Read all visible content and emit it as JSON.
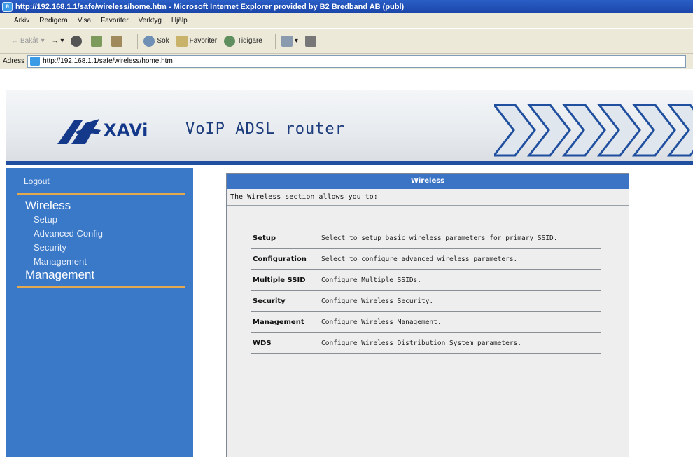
{
  "window": {
    "title": "http://192.168.1.1/safe/wireless/home.htm - Microsoft Internet Explorer provided by B2 Bredband AB (publ)"
  },
  "menu": [
    "Arkiv",
    "Redigera",
    "Visa",
    "Favoriter",
    "Verktyg",
    "Hjälp"
  ],
  "toolbar": {
    "back": "Bakåt",
    "search": "Sök",
    "favorites": "Favoriter",
    "history": "Tidigare"
  },
  "address": {
    "label": "Adress",
    "url": "http://192.168.1.1/safe/wireless/home.htm"
  },
  "banner": {
    "logo_text": "XAVi",
    "title": "VoIP ADSL router"
  },
  "sidebar": {
    "logout": "Logout",
    "sections": [
      {
        "label": "Wireless",
        "items": [
          "Setup",
          "Advanced Config",
          "Security",
          "Management"
        ]
      },
      {
        "label": "Management",
        "items": []
      }
    ]
  },
  "panel": {
    "header": "Wireless",
    "intro": "The Wireless section allows you to:",
    "options": [
      {
        "name": "Setup",
        "desc": "Select to setup basic wireless parameters for primary SSID."
      },
      {
        "name": "Configuration",
        "desc": "Select to configure advanced wireless parameters."
      },
      {
        "name": "Multiple SSID",
        "desc": "Configure Multiple SSIDs."
      },
      {
        "name": "Security",
        "desc": "Configure Wireless Security."
      },
      {
        "name": "Management",
        "desc": "Configure Wireless Management."
      },
      {
        "name": "WDS",
        "desc": "Configure Wireless Distribution System parameters."
      }
    ]
  },
  "colors": {
    "sidebar": "#3a78c8",
    "accent_rule": "#e4a84e",
    "panel_header": "#3b74c4",
    "brand": "#14388a"
  }
}
